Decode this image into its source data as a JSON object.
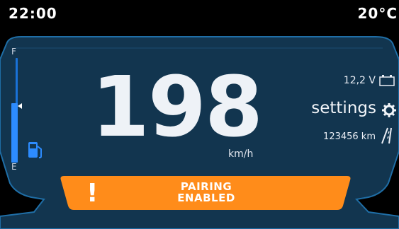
{
  "status_bar": {
    "time": "22:00",
    "temperature": "20°C"
  },
  "fuel_gauge": {
    "full_label": "F",
    "empty_label": "E",
    "level_fraction": 0.57
  },
  "speedometer": {
    "value": "198",
    "unit": "km/h"
  },
  "right_panel": {
    "voltage": "12,2 V",
    "settings_label": "settings",
    "odometer": "123456 km"
  },
  "alert": {
    "line1": "PAIRING",
    "line2": "ENABLED",
    "symbol": "!"
  },
  "colors": {
    "panel": "#12354f",
    "panel_border": "#1f6ea6",
    "alert": "#ff8c1a",
    "fuel": "#2d8cff"
  },
  "icons": [
    "fuel-pump-icon",
    "battery-icon",
    "gear-icon",
    "road-icon",
    "warning-icon"
  ]
}
